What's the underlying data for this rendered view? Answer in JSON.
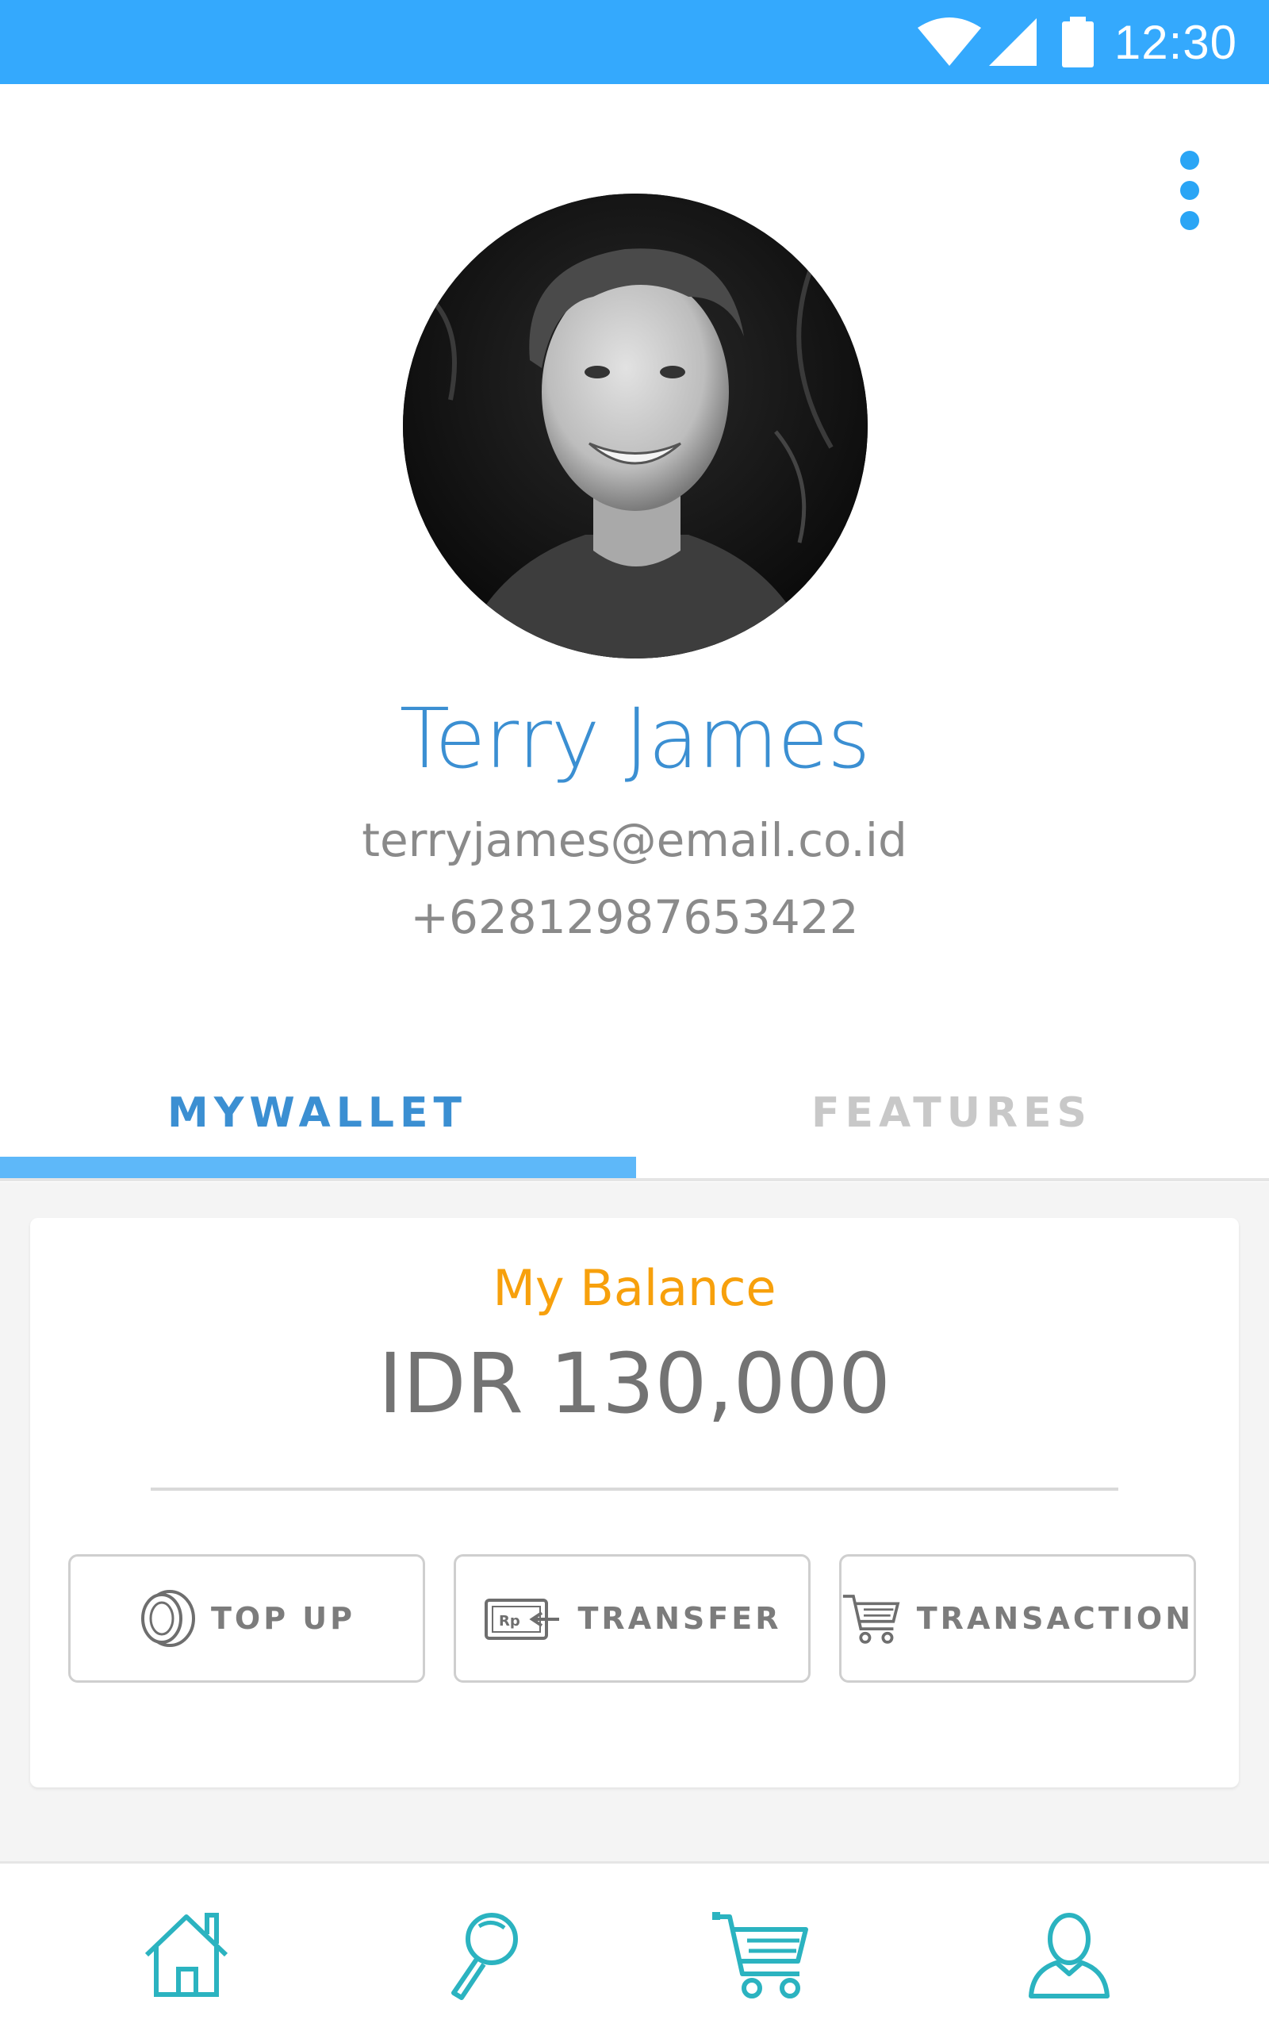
{
  "status_bar": {
    "time": "12:30",
    "icons": [
      "wifi-icon",
      "signal-icon",
      "battery-icon"
    ],
    "background": "#34a9fd"
  },
  "header": {
    "menu_icon": "more-vert-icon"
  },
  "profile": {
    "name": "Terry James",
    "email": "terryjames@email.co.id",
    "phone": "+62812987653422"
  },
  "tabs": [
    {
      "label": "MYWALLET",
      "active": true
    },
    {
      "label": "FEATURES",
      "active": false
    }
  ],
  "wallet": {
    "balance_label": "My Balance",
    "balance_amount": "IDR 130,000",
    "actions": [
      {
        "label": "TOP UP",
        "icon": "coin-icon"
      },
      {
        "label": "TRANSFER",
        "icon": "transfer-rp-icon"
      },
      {
        "label": "TRANSACTION",
        "icon": "cart-icon"
      }
    ]
  },
  "bottom_nav": {
    "items": [
      {
        "name": "home",
        "icon": "home-icon"
      },
      {
        "name": "search",
        "icon": "search-icon"
      },
      {
        "name": "cart",
        "icon": "cart-icon"
      },
      {
        "name": "profile",
        "icon": "user-icon"
      }
    ],
    "icon_color": "#2bb3c0"
  },
  "colors": {
    "accent": "#3b8fd2",
    "balance_label": "#f7a00c",
    "tab_indicator": "#5eb8f9"
  }
}
